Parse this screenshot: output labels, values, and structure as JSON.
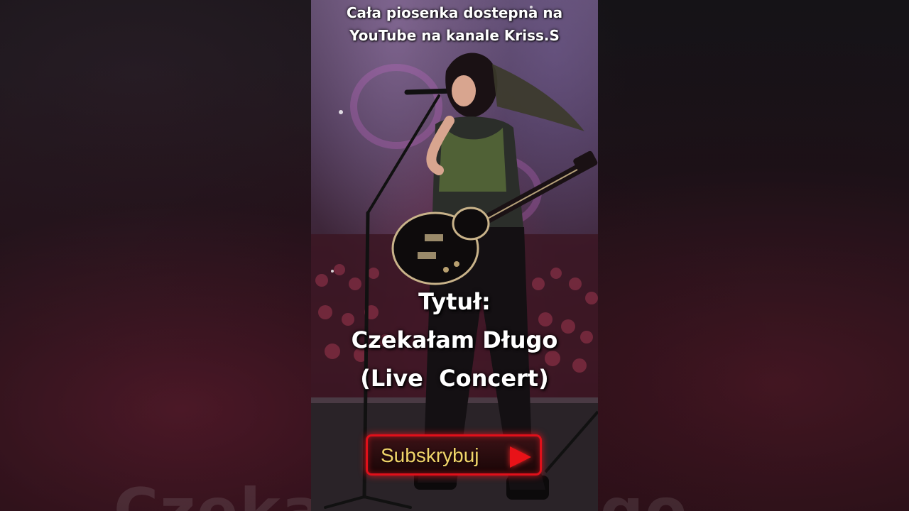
{
  "video": {
    "top_caption_line1": "Cała piosenka dostepna na",
    "top_caption_line2": "YouTube na kanale Kriss.S",
    "title_line1": "Tytuł:",
    "title_line2": "Czekałam Długo",
    "title_line3": "(Live  Concert)",
    "subscribe_label": "Subskrybuj",
    "play_icon": "play-triangle-icon"
  },
  "backdrop": {
    "bottom_text": "Czekałam Długo"
  },
  "colors": {
    "subscribe_border": "#e0101a",
    "subscribe_text": "#f1d56a",
    "play_icon": "#e81218",
    "caption_text": "#ffffff"
  }
}
